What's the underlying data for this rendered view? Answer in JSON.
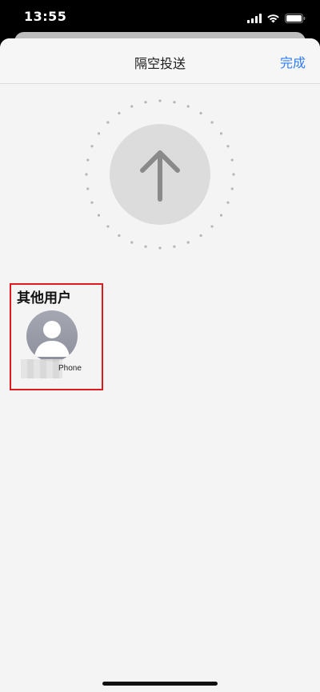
{
  "status_bar": {
    "time": "13:55",
    "icons": [
      "signal-icon",
      "wifi-icon",
      "battery-icon"
    ]
  },
  "sheet": {
    "title": "隔空投送",
    "done_label": "完成"
  },
  "radar": {
    "icon": "arrow-up-icon"
  },
  "other_users": {
    "heading": "其他用户",
    "devices": [
      {
        "name_visible": "Phone",
        "avatar": "person-icon"
      }
    ]
  },
  "colors": {
    "accent": "#2f7df6",
    "highlight": "#e0191f",
    "sheet_bg": "#f4f4f4"
  }
}
